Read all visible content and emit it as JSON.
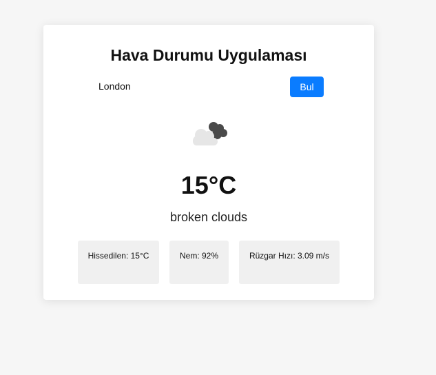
{
  "app": {
    "title": "Hava Durumu Uygulaması"
  },
  "search": {
    "value": "London",
    "button_label": "Bul"
  },
  "weather": {
    "icon": "broken-clouds-icon",
    "temperature": "15°C",
    "description": "broken clouds"
  },
  "details": {
    "feels_like": "Hissedilen: 15°C",
    "humidity": "Nem: 92%",
    "wind_speed": "Rüzgar Hızı: 3.09 m/s"
  },
  "colors": {
    "accent": "#0a7cff",
    "background": "#f6f6f6",
    "card": "#ffffff",
    "detail_box": "#f0f0f0"
  }
}
